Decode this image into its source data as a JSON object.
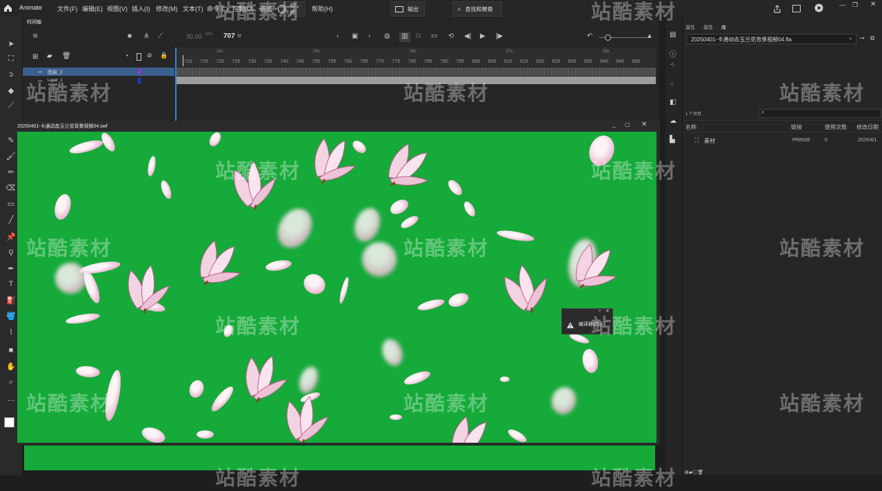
{
  "app": {
    "name": "Animate"
  },
  "menu": [
    "文件(F)",
    "编辑(E)",
    "视图(V)",
    "插入(I)",
    "修改(M)",
    "文本(T)",
    "命令(C)",
    "控制(O)",
    "调试",
    "帮助(H)"
  ],
  "top_buttons": {
    "actions": "动作",
    "output": "输出",
    "find_replace": "查找和替换"
  },
  "timeline": {
    "tab": "时间轴",
    "fps": "30.00",
    "fps_unit": "FPS",
    "current_frame": "707",
    "frame_unit": "帧",
    "seconds": [
      "24s",
      "25s",
      "26s",
      "27s",
      "28s"
    ],
    "frames": [
      "710",
      "715",
      "720",
      "725",
      "730",
      "735",
      "740",
      "745",
      "750",
      "755",
      "760",
      "765",
      "770",
      "775",
      "780",
      "785",
      "790",
      "795",
      "800",
      "805",
      "810",
      "815",
      "820",
      "825",
      "830",
      "835",
      "840",
      "845",
      "850"
    ],
    "layers": [
      {
        "name": "图层_2",
        "color": "#9b30d0",
        "selected": true
      },
      {
        "name": "Layer_1",
        "color": "#1f3dd6",
        "selected": false
      }
    ]
  },
  "stage": {
    "title": "20250401-卡通动态玉兰花背景视频04.swf",
    "background": "#15aa3a"
  },
  "popup": {
    "label": "编译器错误"
  },
  "library": {
    "tabs": [
      "属性",
      "属性",
      "库"
    ],
    "document": "20250401-卡通动态玉兰花背景视频04.fla",
    "item_count": "1 个项目",
    "columns": [
      "名称",
      "链接",
      "使用次数",
      "修改日期"
    ],
    "items": [
      {
        "name": "素材",
        "linkage": "PRINSE",
        "uses": "0",
        "modified": "2025/4/1"
      }
    ]
  },
  "watermark": "站酷素材",
  "icons": [
    "home-icon",
    "camera-icon",
    "layers-icon",
    "playhead-icon",
    "play-icon",
    "warning-icon",
    "share-icon",
    "search-icon"
  ]
}
